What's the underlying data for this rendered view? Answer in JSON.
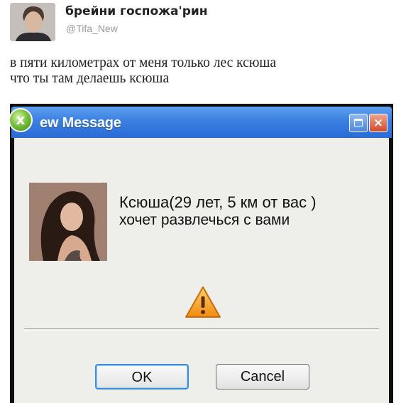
{
  "tweet": {
    "display_name": "брейни госпожа'рин",
    "handle": "@Tifa_New",
    "text_lines": [
      "в пяти километрах от меня только лес ксюша",
      "что ты там делаешь ксюша"
    ]
  },
  "dialog": {
    "title": "ew Message",
    "app_icon_glyph": "x",
    "title_buttons": {
      "maximize": "maximize-icon",
      "close": "×"
    },
    "notice_name": "Ксюша(29 лет, 5 км от вас )",
    "notice_text": "хочет развлечься с вами",
    "warning_icon": "warning-icon",
    "ok_label": "OK",
    "cancel_label": "Cancel",
    "colors": {
      "titlebar": "#3b7fe2",
      "body": "#eeeeea",
      "warning": "#f59a1c",
      "ok_border": "#3f8fd8"
    }
  }
}
